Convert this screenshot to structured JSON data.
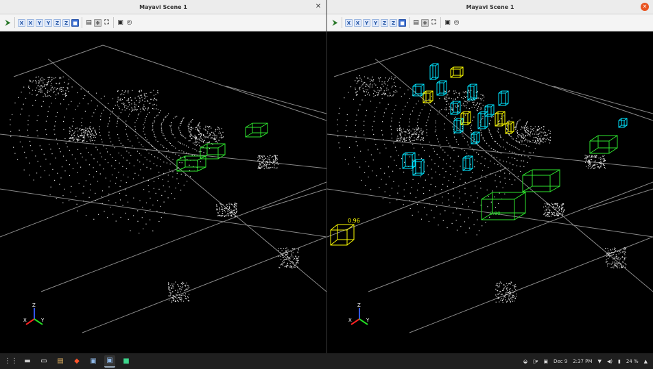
{
  "left_window": {
    "title": "Mayavi Scene 1",
    "close_glyph": "✕"
  },
  "right_window": {
    "title": "Mayavi Scene 1",
    "close_glyph": "✕",
    "labels": [
      "0.96",
      "0.90"
    ]
  },
  "toolbar_icons": [
    "mayavi-icon",
    "view-x-icon",
    "view-minus-x-icon",
    "view-y-icon",
    "view-minus-y-icon",
    "view-z-icon",
    "view-minus-z-icon",
    "isometric-icon",
    "parallel-projection-icon",
    "interaction-icon",
    "fullscreen-icon",
    "save-icon",
    "settings-icon"
  ],
  "axes": {
    "x": "X",
    "y": "Y",
    "z": "Z"
  },
  "colors": {
    "gt_box": "#2ee62e",
    "pred_box": "#00e5ff",
    "score_box": "#ffff00",
    "points": "#dddddd"
  },
  "taskbar": {
    "apps": [
      "apps-grid-icon",
      "files-icon",
      "terminal-icon",
      "text-editor-icon",
      "brave-icon",
      "image-viewer-icon",
      "mayavi-window-icon",
      "pycharm-icon"
    ],
    "date": "Dec 9",
    "time": "2:37 PM",
    "battery": "24 %"
  }
}
